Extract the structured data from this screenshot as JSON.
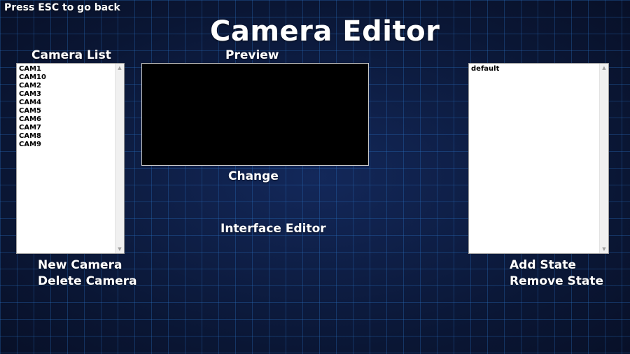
{
  "header": {
    "esc_hint": "Press ESC to go back",
    "title": "Camera Editor"
  },
  "camera_panel": {
    "label": "Camera List",
    "items": [
      "CAM1",
      "CAM10",
      "CAM2",
      "CAM3",
      "CAM4",
      "CAM5",
      "CAM6",
      "CAM7",
      "CAM8",
      "CAM9"
    ],
    "new_label": "New Camera",
    "delete_label": "Delete Camera"
  },
  "preview_panel": {
    "label": "Preview",
    "change_label": "Change",
    "interface_editor_label": "Interface Editor"
  },
  "state_panel": {
    "items": [
      "default"
    ],
    "add_label": "Add State",
    "remove_label": "Remove State"
  },
  "colors": {
    "background": "#0b1a3a",
    "grid": "#286ebe",
    "text": "#ffffff",
    "preview": "#000000"
  }
}
